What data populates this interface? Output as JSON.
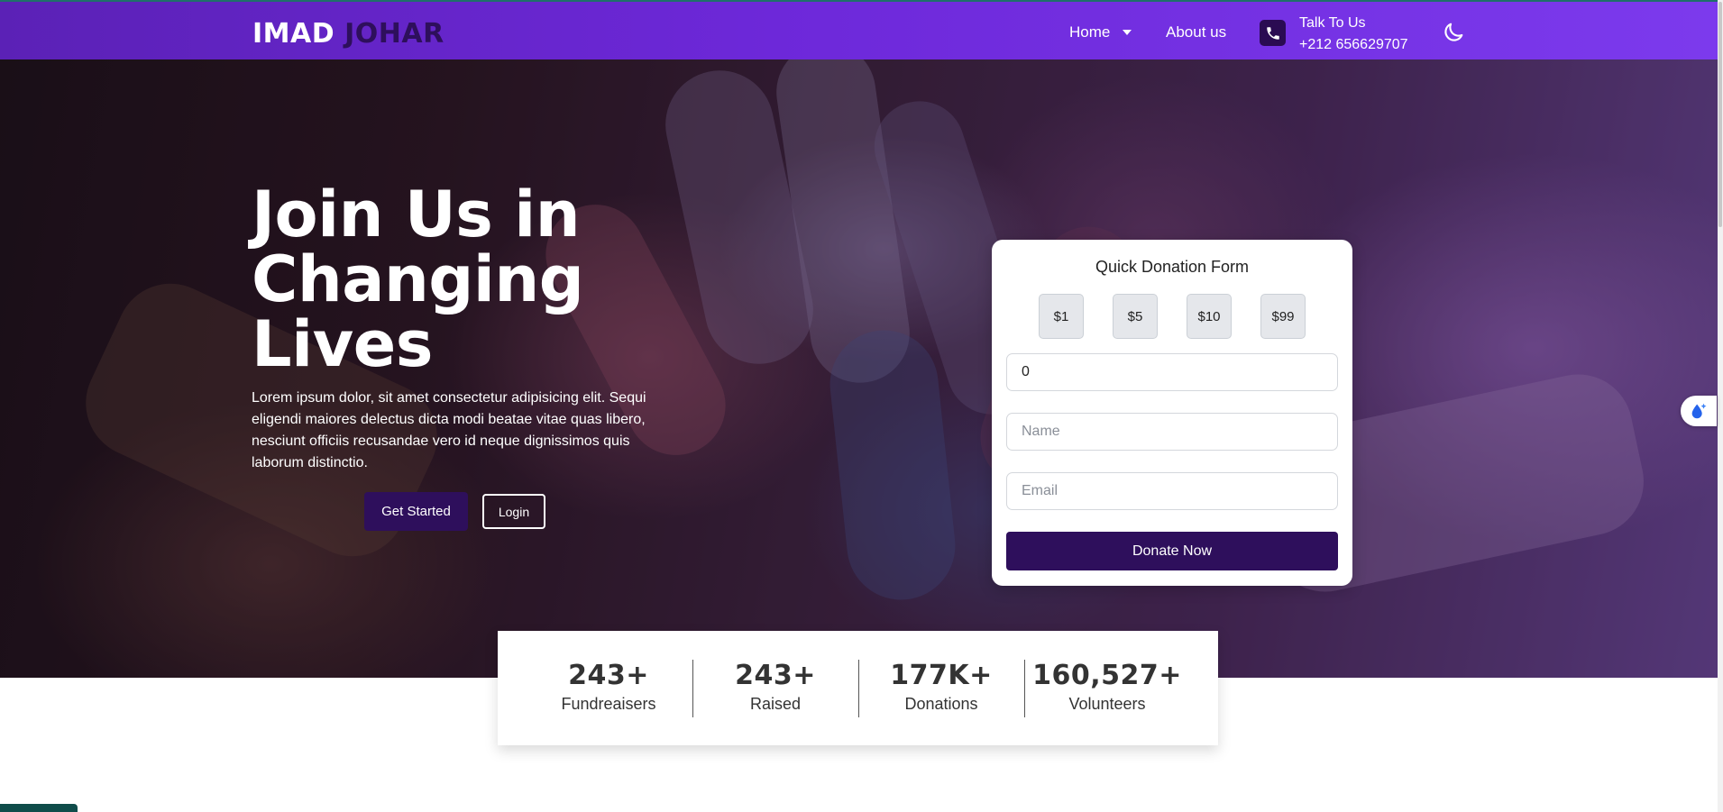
{
  "brand": {
    "part1": "IMAD",
    "part2": "JOHAR"
  },
  "nav": {
    "home_label": "Home",
    "about_label": "About us",
    "contact_title": "Talk To Us",
    "contact_phone": "+212 656629707",
    "icons": {
      "phone": "phone-icon",
      "theme": "moon-icon",
      "dropdown": "chevron-down-icon"
    }
  },
  "hero": {
    "title_line1": "Join Us in",
    "title_line2": "Changing",
    "title_line3": "Lives",
    "description": "Lorem ipsum dolor, sit amet consectetur adipisicing elit. Sequi eligendi maiores delectus dicta modi beatae vitae quas libero, nesciunt officiis recusandae vero id neque dignissimos quis laborum distinctio.",
    "primary_button": "Get Started",
    "secondary_button": "Login"
  },
  "donation_form": {
    "title": "Quick Donation Form",
    "amounts": [
      "$1",
      "$5",
      "$10",
      "$99"
    ],
    "amount_value": "0",
    "name_placeholder": "Name",
    "email_placeholder": "Email",
    "submit_label": "Donate Now"
  },
  "stats": [
    {
      "value": "243+",
      "label": "Fundreaisers"
    },
    {
      "value": "243+",
      "label": "Raised"
    },
    {
      "value": "177K+",
      "label": "Donations"
    },
    {
      "value": "160,527+",
      "label": "Volunteers"
    }
  ],
  "colors": {
    "navbar": "#6d28d9",
    "primary_dark": "#2e0f5c",
    "card_bg": "#ffffff"
  }
}
